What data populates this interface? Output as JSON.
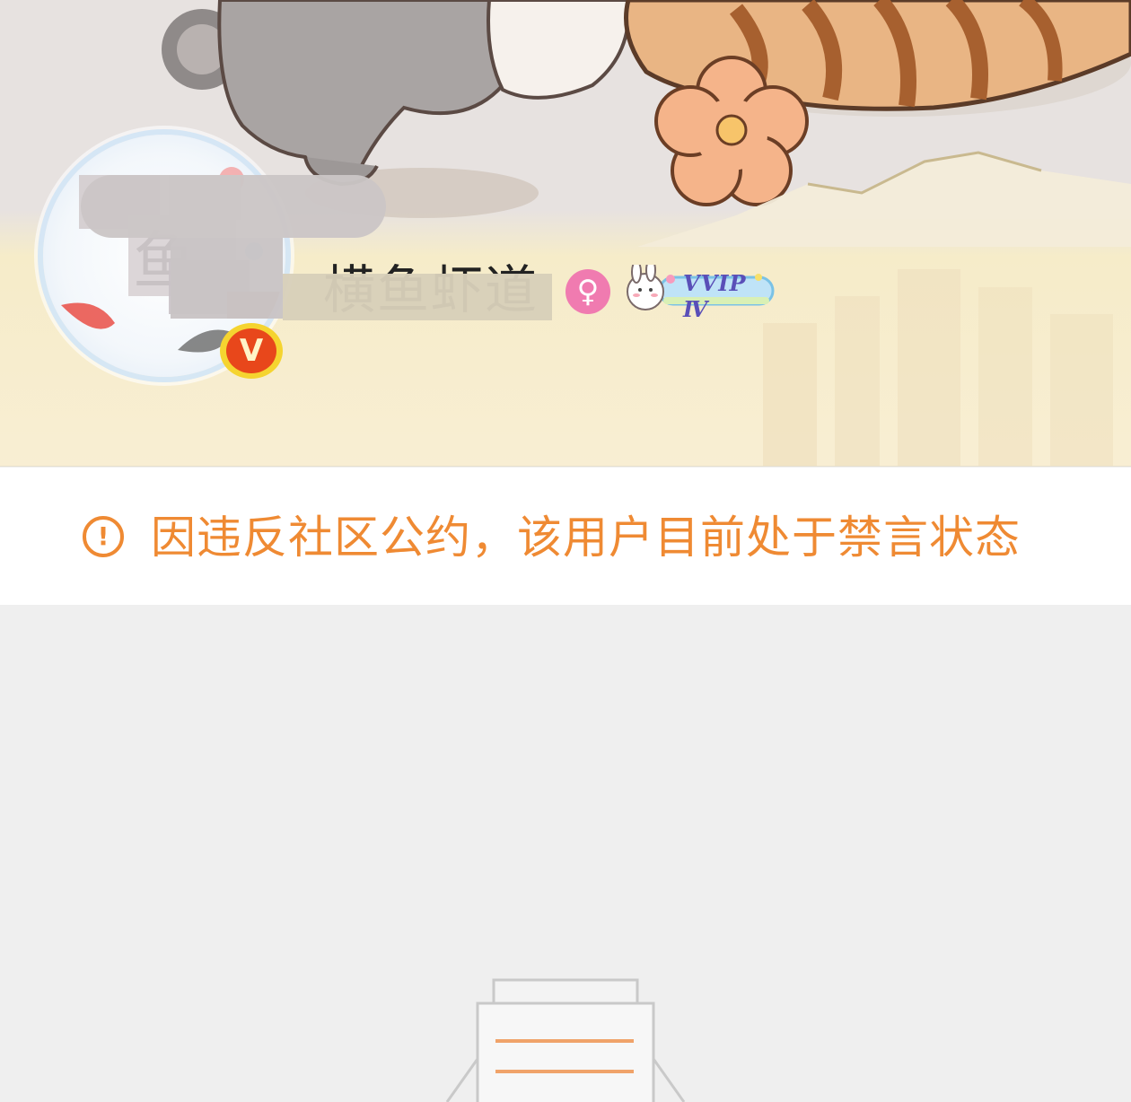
{
  "profile": {
    "username": "横鱼虾道",
    "gender_icon": "female-icon",
    "gender_symbol": "♀",
    "verified_badge": "V",
    "vip_label": "VVIP Ⅳ"
  },
  "notice": {
    "icon": "alert-circle-icon",
    "icon_glyph": "!",
    "text": "因违反社区公约，该用户目前处于禁言状态"
  },
  "colors": {
    "notice_orange": "#ef8a33",
    "gender_pink": "#f07bb0",
    "badge_red": "#e8471b",
    "badge_yellow": "#f5d430"
  }
}
